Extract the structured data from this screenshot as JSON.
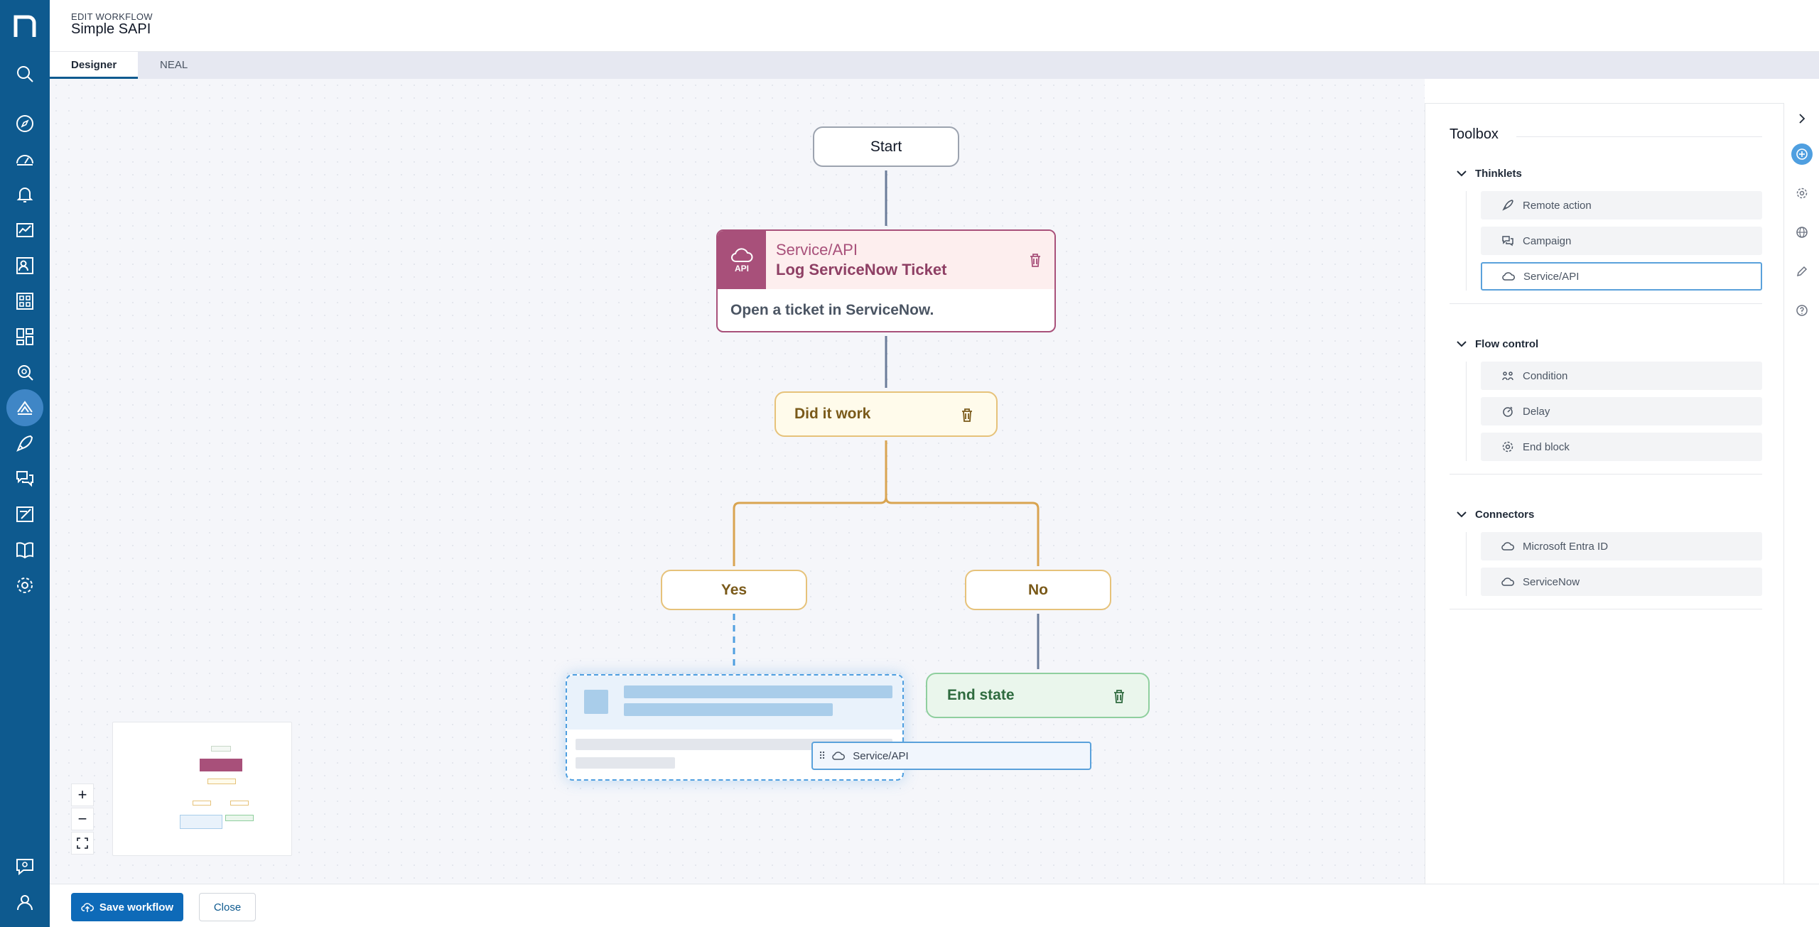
{
  "header": {
    "overline": "EDIT WORKFLOW",
    "title": "Simple SAPI"
  },
  "tabs": [
    {
      "label": "Designer"
    },
    {
      "label": "NEAL"
    }
  ],
  "workflow": {
    "start": "Start",
    "api_node": {
      "kind": "Service/API",
      "name": "Log ServiceNow Ticket",
      "description": "Open a ticket in ServiceNow.",
      "badge": "API"
    },
    "condition": "Did it work",
    "yes": "Yes",
    "no": "No",
    "end": "End state"
  },
  "drag_item": {
    "label": "Service/API"
  },
  "toolbox": {
    "title": "Toolbox",
    "groups": [
      {
        "title": "Thinklets",
        "items": [
          {
            "label": "Remote action",
            "icon": "rocket-icon"
          },
          {
            "label": "Campaign",
            "icon": "chat-bubbles-icon"
          },
          {
            "label": "Service/API",
            "icon": "cloud-api-icon"
          }
        ]
      },
      {
        "title": "Flow control",
        "items": [
          {
            "label": "Condition",
            "icon": "branch-icon"
          },
          {
            "label": "Delay",
            "icon": "stopwatch-icon"
          },
          {
            "label": "End block",
            "icon": "gear-icon"
          }
        ]
      },
      {
        "title": "Connectors",
        "items": [
          {
            "label": "Microsoft Entra ID",
            "icon": "cloud-api-icon"
          },
          {
            "label": "ServiceNow",
            "icon": "cloud-api-icon"
          }
        ]
      }
    ]
  },
  "footer": {
    "save_label": "Save workflow",
    "close_label": "Close"
  },
  "zoom": {
    "in": "+",
    "out": "−"
  },
  "colors": {
    "nav": "#0e5a8f",
    "api": "#a8507a",
    "condition": "#e6c27a",
    "end": "#8fcf9e",
    "accent": "#4f9fe0"
  }
}
